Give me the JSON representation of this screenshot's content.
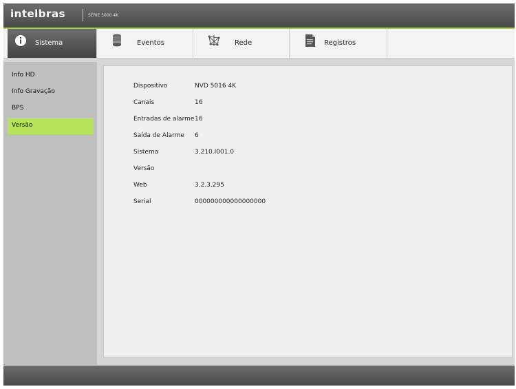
{
  "header": {
    "brand": "intelbras",
    "series": "SÉRIE 5000 4K"
  },
  "tabs": [
    {
      "label": "Sistema",
      "icon": "info-icon"
    },
    {
      "label": "Eventos",
      "icon": "database-icon"
    },
    {
      "label": "Rede",
      "icon": "network-icon"
    },
    {
      "label": "Registros",
      "icon": "document-icon"
    }
  ],
  "sidebar": {
    "items": [
      {
        "label": "Info HD"
      },
      {
        "label": "Info Gravação"
      },
      {
        "label": "BPS"
      },
      {
        "label": "Versão"
      }
    ],
    "active_color": "#b5e35b"
  },
  "version_info": {
    "rows": [
      {
        "key": "Dispositivo",
        "value": "NVD 5016 4K"
      },
      {
        "key": "Canais",
        "value": "16"
      },
      {
        "key": "Entradas de alarme",
        "value": "16"
      },
      {
        "key": "Saída de Alarme",
        "value": "6"
      },
      {
        "key": "Sistema",
        "value": "3.210.I001.0"
      },
      {
        "key": "Versão",
        "value": ""
      },
      {
        "key": "Web",
        "value": "3.2.3.295"
      },
      {
        "key": "Serial",
        "value": "000000000000000000"
      }
    ]
  },
  "colors": {
    "accent": "#a8cf45",
    "header_bg": "#555555"
  }
}
